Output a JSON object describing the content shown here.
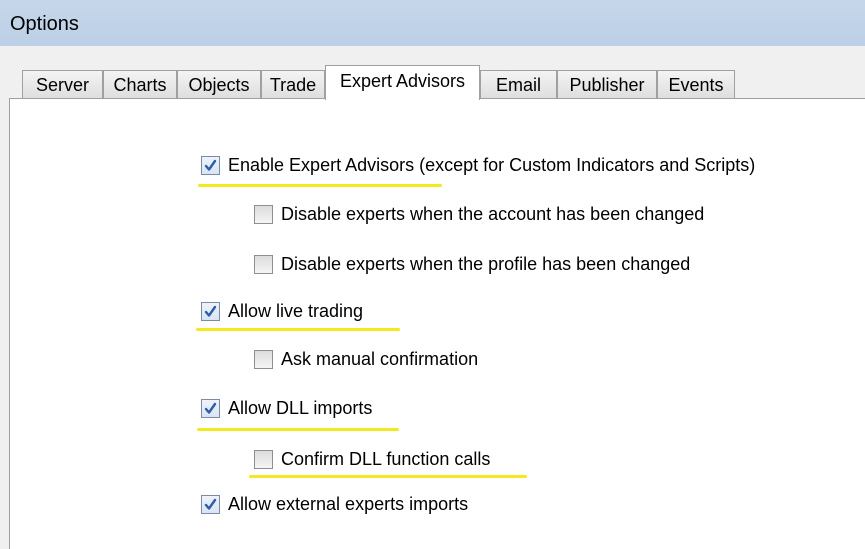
{
  "window": {
    "title": "Options"
  },
  "tabs": [
    {
      "label": "Server"
    },
    {
      "label": "Charts"
    },
    {
      "label": "Objects"
    },
    {
      "label": "Trade"
    },
    {
      "label": "Expert Advisors",
      "active": true
    },
    {
      "label": "Email"
    },
    {
      "label": "Publisher"
    },
    {
      "label": "Events"
    }
  ],
  "options": {
    "enable_experts": {
      "label": "Enable Expert Advisors (except for Custom Indicators and Scripts)",
      "checked": true
    },
    "disable_on_account_change": {
      "label": "Disable experts when the account has been changed",
      "checked": false
    },
    "disable_on_profile_change": {
      "label": "Disable experts when the profile has been changed",
      "checked": false
    },
    "allow_live_trading": {
      "label": "Allow live trading",
      "checked": true
    },
    "ask_manual_confirmation": {
      "label": "Ask manual confirmation",
      "checked": false
    },
    "allow_dll_imports": {
      "label": "Allow DLL imports",
      "checked": true
    },
    "confirm_dll_calls": {
      "label": "Confirm DLL function calls",
      "checked": false
    },
    "allow_external_imports": {
      "label": "Allow external experts imports",
      "checked": true
    }
  },
  "colors": {
    "highlight": "#f4e91f",
    "check": "#2a5ea8"
  }
}
